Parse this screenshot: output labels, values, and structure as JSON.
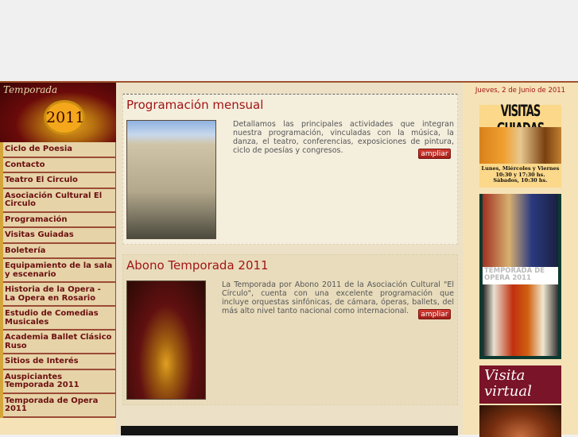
{
  "logo": {
    "script": "Temporada",
    "year": "2011"
  },
  "nav": [
    "Ciclo de Poesia",
    "Contacto",
    "Teatro El Circulo",
    "Asociación Cultural El Circulo",
    "Programación",
    "Visitas Guiadas",
    "Boletería",
    "Equipamiento de la sala y escenario",
    "Historia de la Opera - La Opera en Rosario",
    "Estudio de Comedias Musicales",
    "Academia Ballet Clásico Ruso",
    "Sitios de Interés",
    "Auspiciantes Temporada 2011",
    "Temporada de Opera 2011"
  ],
  "main": {
    "sections": [
      {
        "title": "Programación mensual",
        "text": "Detallamos las principales actividades que integran nuestra programación, vinculadas con la música, la danza, el teatro, conferencias, exposiciones de pintura, ciclo de poesías y congresos.",
        "button": "ampliar"
      },
      {
        "title": "Abono Temporada 2011",
        "text": "La Temporada por Abono 2011 de la Asociación Cultural \"El Círculo\", cuenta con una excelente programación que incluye orquestas sinfónicas, de cámara, óperas, ballets, del más alto nivel tanto nacional como internacional.",
        "button": "ampliar"
      }
    ]
  },
  "right": {
    "date": "Jueves, 2 de Junio de 2011",
    "visitas": {
      "title": "VISITAS GUIADAS",
      "schedule": [
        "Lunes, Miércoles y Viernes",
        "10:30 y 17:30 hs.",
        "Sábados, 10:30 hs."
      ]
    },
    "opera": {
      "title": "TEMPORADA DE OPERA 2011"
    },
    "virtual": {
      "title": "Visita virtual"
    }
  }
}
